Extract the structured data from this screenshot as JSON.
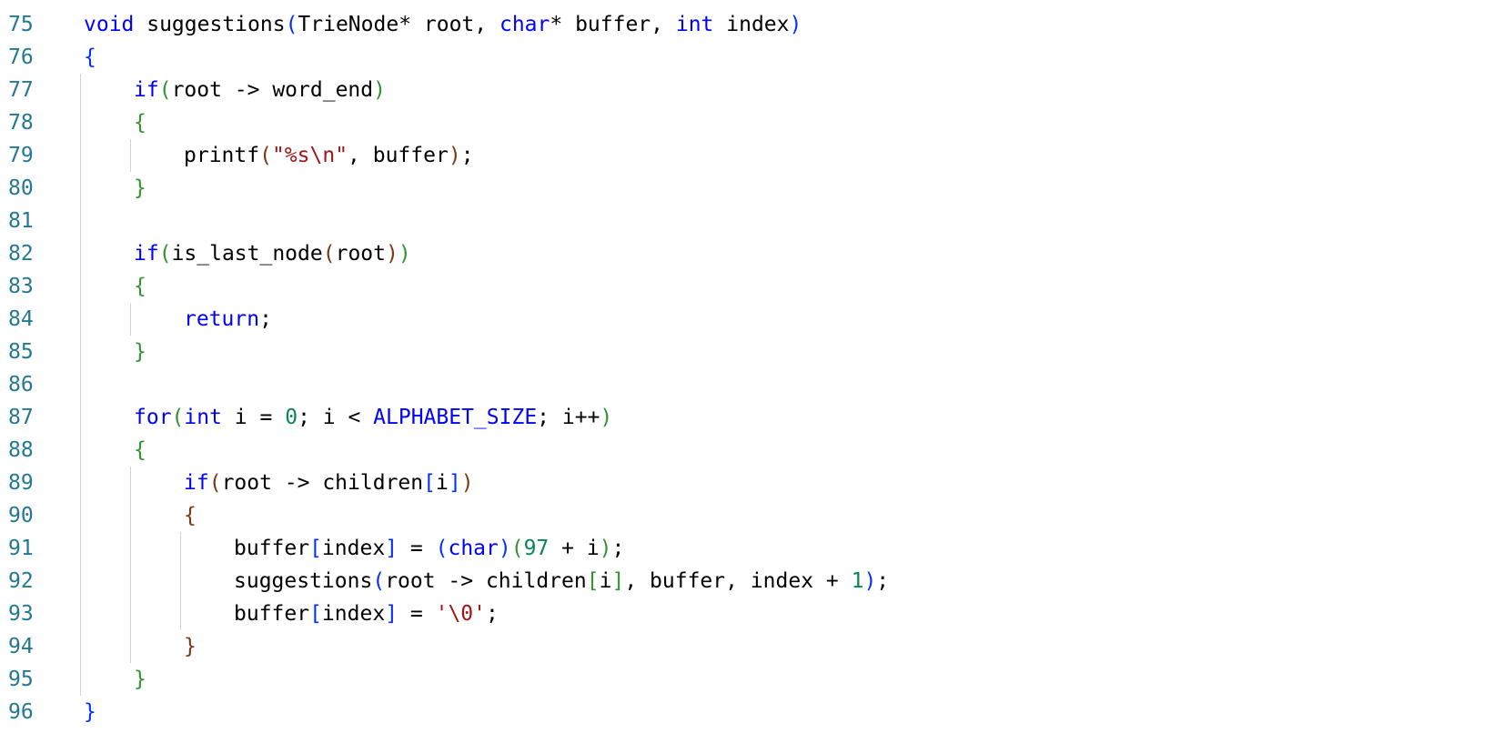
{
  "editor": {
    "lines": [
      {
        "num": "75",
        "indent": 0,
        "tokens": [
          {
            "t": "void",
            "c": "kw"
          },
          {
            "t": " suggestions",
            "c": "fn"
          },
          {
            "t": "(",
            "c": "b1"
          },
          {
            "t": "TrieNode* root, ",
            "c": ""
          },
          {
            "t": "char",
            "c": "kw"
          },
          {
            "t": "* buffer, ",
            "c": ""
          },
          {
            "t": "int",
            "c": "kw"
          },
          {
            "t": " index",
            "c": ""
          },
          {
            "t": ")",
            "c": "b1"
          }
        ]
      },
      {
        "num": "76",
        "indent": 0,
        "tokens": [
          {
            "t": "{",
            "c": "b1"
          }
        ]
      },
      {
        "num": "77",
        "indent": 1,
        "tokens": [
          {
            "t": "if",
            "c": "kw"
          },
          {
            "t": "(",
            "c": "b2"
          },
          {
            "t": "root -> word_end",
            "c": ""
          },
          {
            "t": ")",
            "c": "b2"
          }
        ]
      },
      {
        "num": "78",
        "indent": 1,
        "tokens": [
          {
            "t": "{",
            "c": "b2"
          }
        ]
      },
      {
        "num": "79",
        "indent": 2,
        "tokens": [
          {
            "t": "printf",
            "c": "fn"
          },
          {
            "t": "(",
            "c": "b3"
          },
          {
            "t": "\"%s\\n\"",
            "c": "str"
          },
          {
            "t": ", buffer",
            "c": ""
          },
          {
            "t": ")",
            "c": "b3"
          },
          {
            "t": ";",
            "c": ""
          }
        ]
      },
      {
        "num": "80",
        "indent": 1,
        "tokens": [
          {
            "t": "}",
            "c": "b2"
          }
        ]
      },
      {
        "num": "81",
        "indent": 1,
        "tokens": []
      },
      {
        "num": "82",
        "indent": 1,
        "tokens": [
          {
            "t": "if",
            "c": "kw"
          },
          {
            "t": "(",
            "c": "b2"
          },
          {
            "t": "is_last_node",
            "c": "fn"
          },
          {
            "t": "(",
            "c": "b3"
          },
          {
            "t": "root",
            "c": ""
          },
          {
            "t": ")",
            "c": "b3"
          },
          {
            "t": ")",
            "c": "b2"
          }
        ]
      },
      {
        "num": "83",
        "indent": 1,
        "tokens": [
          {
            "t": "{",
            "c": "b2"
          }
        ]
      },
      {
        "num": "84",
        "indent": 2,
        "tokens": [
          {
            "t": "return",
            "c": "kw"
          },
          {
            "t": ";",
            "c": ""
          }
        ]
      },
      {
        "num": "85",
        "indent": 1,
        "tokens": [
          {
            "t": "}",
            "c": "b2"
          }
        ]
      },
      {
        "num": "86",
        "indent": 1,
        "tokens": []
      },
      {
        "num": "87",
        "indent": 1,
        "tokens": [
          {
            "t": "for",
            "c": "kw"
          },
          {
            "t": "(",
            "c": "b2"
          },
          {
            "t": "int",
            "c": "kw"
          },
          {
            "t": " i = ",
            "c": ""
          },
          {
            "t": "0",
            "c": "num"
          },
          {
            "t": "; i < ",
            "c": ""
          },
          {
            "t": "ALPHABET_SIZE",
            "c": "macro"
          },
          {
            "t": "; i++",
            "c": ""
          },
          {
            "t": ")",
            "c": "b2"
          }
        ]
      },
      {
        "num": "88",
        "indent": 1,
        "tokens": [
          {
            "t": "{",
            "c": "b2"
          }
        ]
      },
      {
        "num": "89",
        "indent": 2,
        "tokens": [
          {
            "t": "if",
            "c": "kw"
          },
          {
            "t": "(",
            "c": "b3"
          },
          {
            "t": "root -> children",
            "c": ""
          },
          {
            "t": "[",
            "c": "b1"
          },
          {
            "t": "i",
            "c": ""
          },
          {
            "t": "]",
            "c": "b1"
          },
          {
            "t": ")",
            "c": "b3"
          }
        ]
      },
      {
        "num": "90",
        "indent": 2,
        "tokens": [
          {
            "t": "{",
            "c": "b3"
          }
        ]
      },
      {
        "num": "91",
        "indent": 3,
        "tokens": [
          {
            "t": "buffer",
            "c": ""
          },
          {
            "t": "[",
            "c": "b1"
          },
          {
            "t": "index",
            "c": ""
          },
          {
            "t": "]",
            "c": "b1"
          },
          {
            "t": " = ",
            "c": ""
          },
          {
            "t": "(",
            "c": "b1"
          },
          {
            "t": "char",
            "c": "kw"
          },
          {
            "t": ")",
            "c": "b1"
          },
          {
            "t": "(",
            "c": "b2"
          },
          {
            "t": "97",
            "c": "num"
          },
          {
            "t": " + i",
            "c": ""
          },
          {
            "t": ")",
            "c": "b2"
          },
          {
            "t": ";",
            "c": ""
          }
        ]
      },
      {
        "num": "92",
        "indent": 3,
        "tokens": [
          {
            "t": "suggestions",
            "c": "fn"
          },
          {
            "t": "(",
            "c": "b1"
          },
          {
            "t": "root -> children",
            "c": ""
          },
          {
            "t": "[",
            "c": "b2"
          },
          {
            "t": "i",
            "c": ""
          },
          {
            "t": "]",
            "c": "b2"
          },
          {
            "t": ", buffer, index + ",
            "c": ""
          },
          {
            "t": "1",
            "c": "num"
          },
          {
            "t": ")",
            "c": "b1"
          },
          {
            "t": ";",
            "c": ""
          }
        ]
      },
      {
        "num": "93",
        "indent": 3,
        "tokens": [
          {
            "t": "buffer",
            "c": ""
          },
          {
            "t": "[",
            "c": "b1"
          },
          {
            "t": "index",
            "c": ""
          },
          {
            "t": "]",
            "c": "b1"
          },
          {
            "t": " = ",
            "c": ""
          },
          {
            "t": "'\\0'",
            "c": "str"
          },
          {
            "t": ";",
            "c": ""
          }
        ]
      },
      {
        "num": "94",
        "indent": 2,
        "tokens": [
          {
            "t": "}",
            "c": "b3"
          }
        ]
      },
      {
        "num": "95",
        "indent": 1,
        "tokens": [
          {
            "t": "}",
            "c": "b2"
          }
        ]
      },
      {
        "num": "96",
        "indent": 0,
        "tokens": [
          {
            "t": "}",
            "c": "b1"
          }
        ]
      }
    ]
  },
  "colors": {
    "line_number": "#237893",
    "keyword": "#0000ff",
    "string": "#a31515",
    "number": "#098658",
    "bracket_level1": "#0431fa",
    "bracket_level2": "#319331",
    "bracket_level3": "#7b3814",
    "indent_guide": "#d3d3d3"
  }
}
